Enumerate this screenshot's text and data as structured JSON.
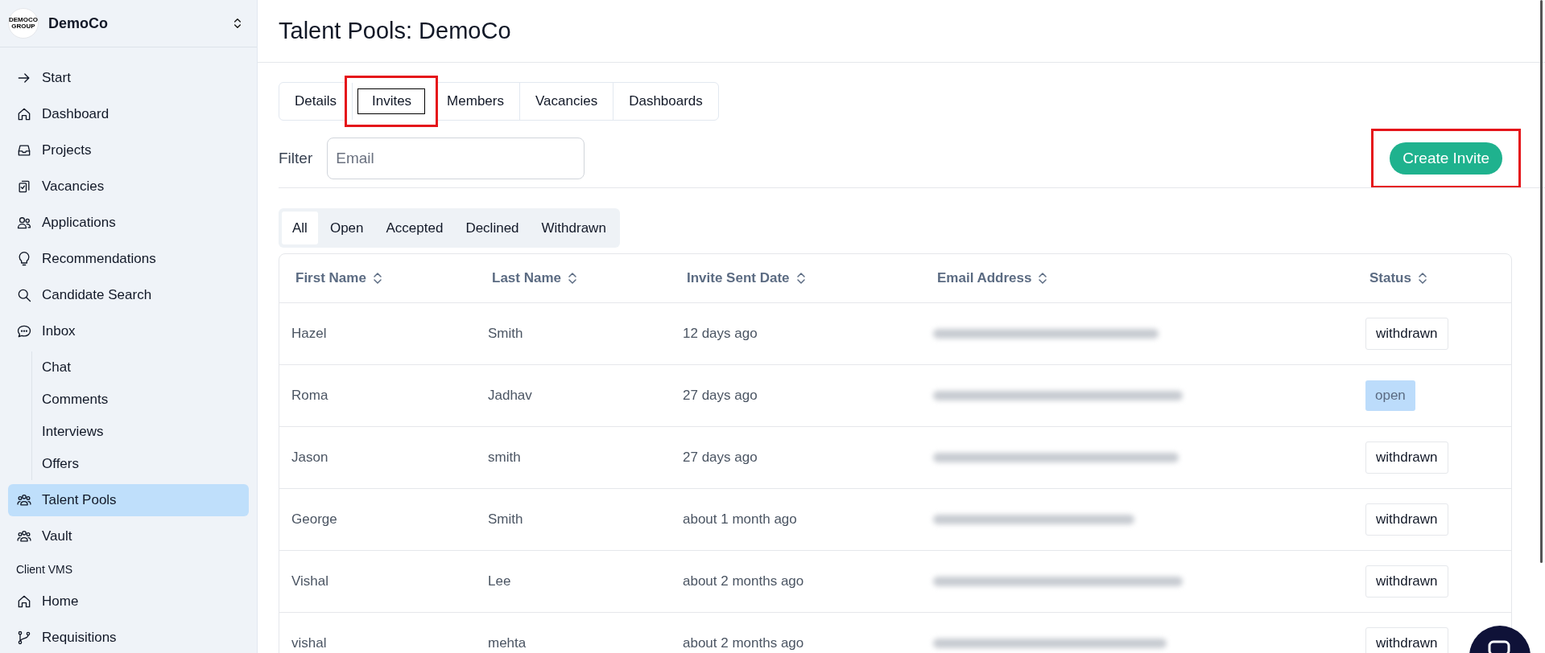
{
  "sidebar": {
    "org": {
      "logo_text": [
        "DEMOCO",
        "GROUP"
      ],
      "name": "DemoCo"
    },
    "items": [
      {
        "label": "Start",
        "selected": false
      },
      {
        "label": "Dashboard",
        "selected": false
      },
      {
        "label": "Projects",
        "selected": false
      },
      {
        "label": "Vacancies",
        "selected": false
      },
      {
        "label": "Applications",
        "selected": false
      },
      {
        "label": "Recommendations",
        "selected": false
      },
      {
        "label": "Candidate Search",
        "selected": false
      },
      {
        "label": "Inbox",
        "selected": false,
        "children": [
          {
            "label": "Chat",
            "selected": false
          },
          {
            "label": "Comments",
            "selected": false
          },
          {
            "label": "Interviews",
            "selected": false
          },
          {
            "label": "Offers",
            "selected": false
          }
        ]
      },
      {
        "label": "Talent Pools",
        "selected": true
      },
      {
        "label": "Vault",
        "selected": false
      }
    ],
    "sections": [
      {
        "title": "Client VMS",
        "items": [
          {
            "label": "Home",
            "selected": false
          },
          {
            "label": "Requisitions",
            "selected": false
          }
        ]
      }
    ]
  },
  "page": {
    "title": "Talent Pools: DemoCo",
    "tabs": [
      {
        "label": "Details",
        "selected": false,
        "highlighted": false
      },
      {
        "label": "Invites",
        "selected": true,
        "highlighted": true
      },
      {
        "label": "Members",
        "selected": false,
        "highlighted": false
      },
      {
        "label": "Vacancies",
        "selected": false,
        "highlighted": false
      },
      {
        "label": "Dashboards",
        "selected": false,
        "highlighted": false
      }
    ],
    "filter": {
      "label": "Filter",
      "placeholder": "Email"
    },
    "create_button": {
      "label": "Create Invite",
      "highlighted": true
    },
    "status_filters": [
      {
        "label": "All",
        "selected": true
      },
      {
        "label": "Open",
        "selected": false
      },
      {
        "label": "Accepted",
        "selected": false
      },
      {
        "label": "Declined",
        "selected": false
      },
      {
        "label": "Withdrawn",
        "selected": false
      }
    ],
    "table": {
      "columns": [
        "First Name",
        "Last Name",
        "Invite Sent Date",
        "Email Address",
        "Status"
      ],
      "rows": [
        {
          "first_name": "Hazel",
          "last_name": "Smith",
          "sent": "12 days ago",
          "status": "withdrawn",
          "kind": "withdrawn"
        },
        {
          "first_name": "Roma",
          "last_name": "Jadhav",
          "sent": "27 days ago",
          "status": "open",
          "kind": "open"
        },
        {
          "first_name": "Jason",
          "last_name": "smith",
          "sent": "27 days ago",
          "status": "withdrawn",
          "kind": "withdrawn"
        },
        {
          "first_name": "George",
          "last_name": "Smith",
          "sent": "about 1 month ago",
          "status": "withdrawn",
          "kind": "withdrawn"
        },
        {
          "first_name": "Vishal",
          "last_name": "Lee",
          "sent": "about 2 months ago",
          "status": "withdrawn",
          "kind": "withdrawn"
        },
        {
          "first_name": "vishal",
          "last_name": "mehta",
          "sent": "about 2 months ago",
          "status": "withdrawn",
          "kind": "withdrawn"
        }
      ]
    }
  }
}
